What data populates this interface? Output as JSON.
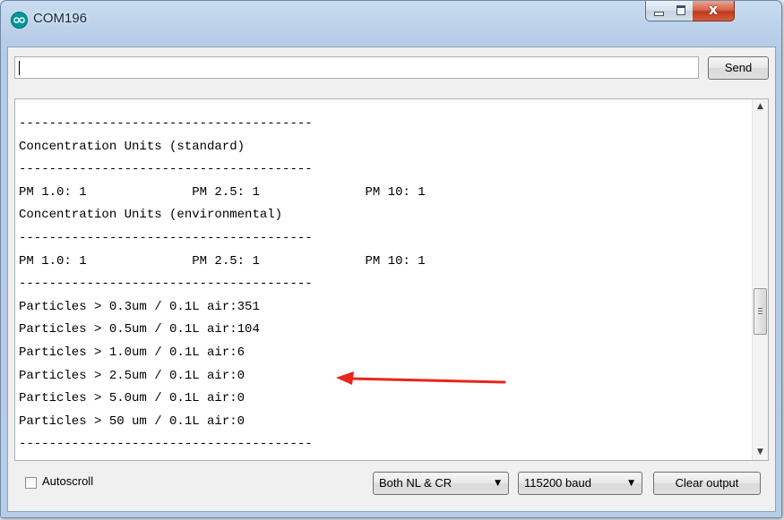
{
  "window": {
    "title": "COM196",
    "close_glyph": "x"
  },
  "send_bar": {
    "input_value": "",
    "send_label": "Send"
  },
  "serial_output": {
    "lines": [
      "---------------------------------------",
      "Concentration Units (standard)",
      "---------------------------------------",
      "PM 1.0: 1              PM 2.5: 1              PM 10: 1",
      "Concentration Units (environmental)",
      "---------------------------------------",
      "PM 1.0: 1              PM 2.5: 1              PM 10: 1",
      "---------------------------------------",
      "Particles > 0.3um / 0.1L air:351",
      "Particles > 0.5um / 0.1L air:104",
      "Particles > 1.0um / 0.1L air:6",
      "Particles > 2.5um / 0.1L air:0",
      "Particles > 5.0um / 0.1L air:0",
      "Particles > 50 um / 0.1L air:0",
      "---------------------------------------"
    ]
  },
  "bottom_bar": {
    "autoscroll_label": "Autoscroll",
    "autoscroll_checked": false,
    "line_ending": "Both NL & CR",
    "baud_rate": "115200 baud",
    "clear_label": "Clear output"
  },
  "icons": {
    "app": "arduino-icon",
    "scroll_up": "scroll-up-arrow-icon",
    "scroll_down": "scroll-down-arrow-icon",
    "dropdown": "chevron-down-icon",
    "annotation": "red-arrow-icon"
  },
  "colors": {
    "arduino_teal": "#00979c",
    "annotation_red": "#e8261c",
    "close_red": "#c2391d"
  }
}
